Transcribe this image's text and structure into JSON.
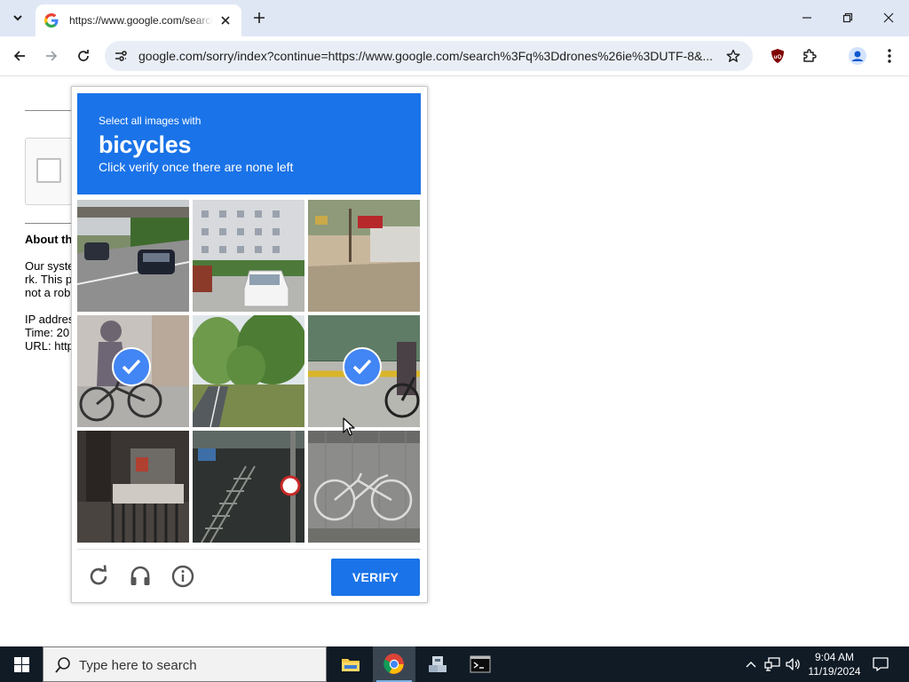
{
  "browser": {
    "tab": {
      "title": "https://www.google.com/search?q=drones",
      "favicon": "google-g-icon"
    },
    "address": "google.com/sorry/index?continue=https://www.google.com/search%3Fq%3Ddrones%26ie%3DUTF-8&..."
  },
  "page": {
    "about_heading": "About th",
    "body_lines": [
      "Our syste",
      "rk. This p",
      "not a rob"
    ],
    "info_lines": [
      "IP addres",
      "Time: 20",
      "URL: http"
    ]
  },
  "recaptcha": {
    "instruction_small": "Select all images with",
    "target": "bicycles",
    "instruction_sub": "Click verify once there are none left",
    "verify_label": "VERIFY",
    "accent_color": "#1a73e8",
    "tiles": [
      {
        "scene": "highway with cars under bridge",
        "selected": false
      },
      {
        "scene": "apartment building with parked white car",
        "selected": false
      },
      {
        "scene": "roadside with red sign and dirt",
        "selected": false
      },
      {
        "scene": "person riding bicycle",
        "selected": true
      },
      {
        "scene": "tree-lined road",
        "selected": false
      },
      {
        "scene": "person with bicycle on yellow line",
        "selected": true
      },
      {
        "scene": "dark building entrance with gate",
        "selected": false
      },
      {
        "scene": "metal stairway with signs",
        "selected": false
      },
      {
        "scene": "bicycle leaning against grey wall",
        "selected": false
      }
    ]
  },
  "taskbar": {
    "search_placeholder": "Type here to search",
    "time": "9:04 AM",
    "date": "11/19/2024"
  }
}
